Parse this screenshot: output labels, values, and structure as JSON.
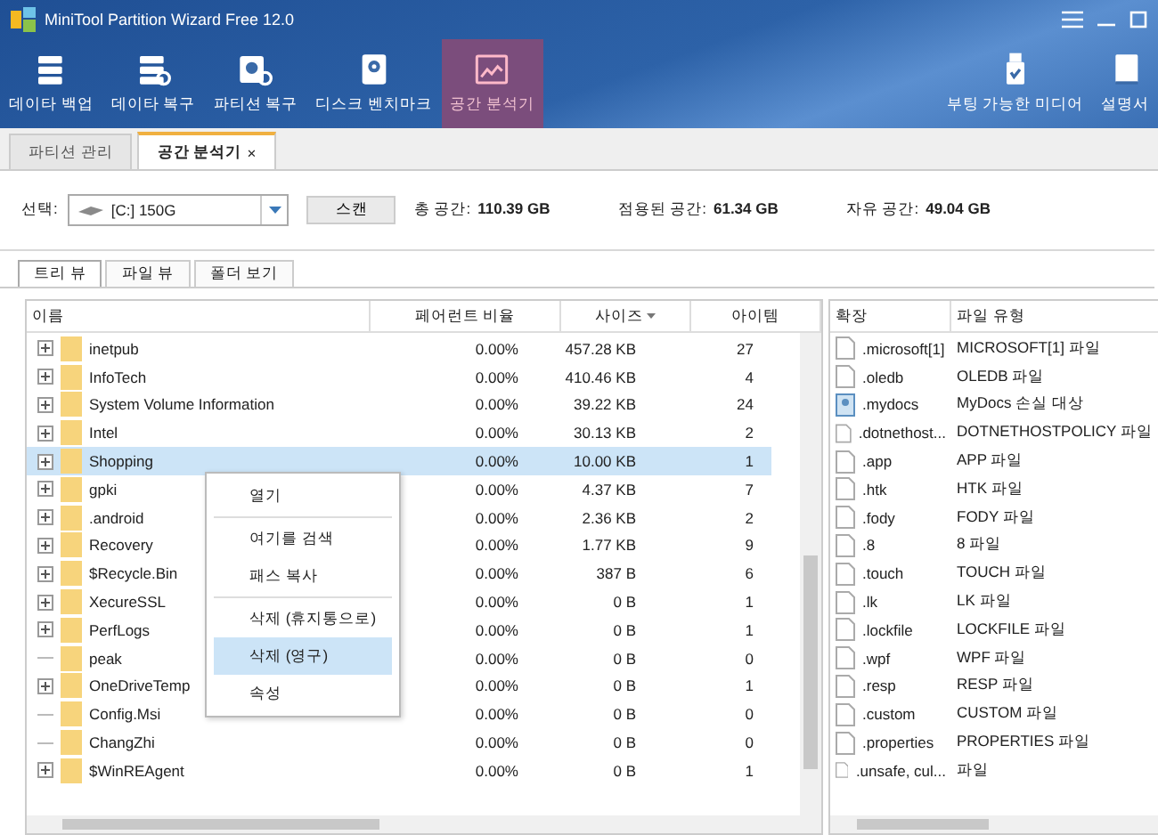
{
  "window": {
    "title": "MiniTool Partition Wizard Free 12.0"
  },
  "toolbar": {
    "left": [
      {
        "label": "데이타 백업",
        "kind": "stack",
        "selected": false
      },
      {
        "label": "데이타 복구",
        "kind": "restore",
        "selected": false
      },
      {
        "label": "파티션 복구",
        "kind": "recover",
        "selected": false
      },
      {
        "label": "디스크 벤치마크",
        "kind": "disk",
        "selected": false
      },
      {
        "label": "공간 분석기",
        "kind": "chart",
        "selected": true
      }
    ],
    "right": [
      {
        "label": "부팅 가능한 미디어",
        "kind": "usb"
      },
      {
        "label": "설명서",
        "kind": "book"
      }
    ]
  },
  "tabs": [
    {
      "label": "파티션 관리",
      "selected": false
    },
    {
      "label": "공간 분석기",
      "selected": true,
      "close": "×"
    }
  ],
  "scan": {
    "label": "선택:",
    "drive": "[C:] 150G",
    "button": "스캔",
    "stats": [
      {
        "label": "총 공간:",
        "value": "110.39 GB"
      },
      {
        "label": "점용된 공간:",
        "value": "61.34 GB"
      },
      {
        "label": "자유 공간:",
        "value": "49.04 GB"
      }
    ]
  },
  "view_tabs": [
    {
      "label": "트리 뷰",
      "selected": true
    },
    {
      "label": "파일 뷰",
      "selected": false
    },
    {
      "label": "폴더 보기",
      "selected": false
    }
  ],
  "tree_table": {
    "columns": [
      {
        "label": "이름",
        "sorted": false
      },
      {
        "label": "페어런트 비율",
        "sorted": false
      },
      {
        "label": "사이즈",
        "sorted": true
      },
      {
        "label": "아이템",
        "sorted": false
      }
    ],
    "rows": [
      {
        "name": "inetpub",
        "ratio": "0.00%",
        "size": "457.28 KB",
        "items": "27",
        "expandable": true,
        "selected": false
      },
      {
        "name": "InfoTech",
        "ratio": "0.00%",
        "size": "410.46 KB",
        "items": "4",
        "expandable": true,
        "selected": false
      },
      {
        "name": "System Volume Information",
        "ratio": "0.00%",
        "size": "39.22 KB",
        "items": "24",
        "expandable": true,
        "selected": false
      },
      {
        "name": "Intel",
        "ratio": "0.00%",
        "size": "30.13 KB",
        "items": "2",
        "expandable": true,
        "selected": false
      },
      {
        "name": "Shopping",
        "ratio": "0.00%",
        "size": "10.00 KB",
        "items": "1",
        "expandable": true,
        "selected": true
      },
      {
        "name": "gpki",
        "ratio": "0.00%",
        "size": "4.37 KB",
        "items": "7",
        "expandable": true,
        "selected": false
      },
      {
        "name": ".android",
        "ratio": "0.00%",
        "size": "2.36 KB",
        "items": "2",
        "expandable": true,
        "selected": false
      },
      {
        "name": "Recovery",
        "ratio": "0.00%",
        "size": "1.77 KB",
        "items": "9",
        "expandable": true,
        "selected": false
      },
      {
        "name": "$Recycle.Bin",
        "ratio": "0.00%",
        "size": "387 B",
        "items": "6",
        "expandable": true,
        "selected": false
      },
      {
        "name": "XecureSSL",
        "ratio": "0.00%",
        "size": "0 B",
        "items": "1",
        "expandable": true,
        "selected": false
      },
      {
        "name": "PerfLogs",
        "ratio": "0.00%",
        "size": "0 B",
        "items": "1",
        "expandable": true,
        "selected": false
      },
      {
        "name": "peak",
        "ratio": "0.00%",
        "size": "0 B",
        "items": "0",
        "expandable": false,
        "selected": false
      },
      {
        "name": "OneDriveTemp",
        "ratio": "0.00%",
        "size": "0 B",
        "items": "1",
        "expandable": true,
        "selected": false
      },
      {
        "name": "Config.Msi",
        "ratio": "0.00%",
        "size": "0 B",
        "items": "0",
        "expandable": false,
        "selected": false
      },
      {
        "name": "ChangZhi",
        "ratio": "0.00%",
        "size": "0 B",
        "items": "0",
        "expandable": false,
        "selected": false
      },
      {
        "name": "$WinREAgent",
        "ratio": "0.00%",
        "size": "0 B",
        "items": "1",
        "expandable": true,
        "selected": false
      }
    ]
  },
  "context_menu": {
    "groups": [
      [
        {
          "label": "열기",
          "selected": false
        }
      ],
      [
        {
          "label": "여기를 검색",
          "selected": false
        },
        {
          "label": "패스 복사",
          "selected": false
        }
      ],
      [
        {
          "label": "삭제 (휴지통으로)",
          "selected": false
        },
        {
          "label": "삭제 (영구)",
          "selected": true
        },
        {
          "label": "속성",
          "selected": false
        }
      ]
    ]
  },
  "extension_table": {
    "columns": [
      "확장",
      "파일 유형"
    ],
    "rows": [
      {
        "ext": ".microsoft[1]",
        "type": "MICROSOFT[1] 파일",
        "kind": "file"
      },
      {
        "ext": ".oledb",
        "type": "OLEDB 파일",
        "kind": "file"
      },
      {
        "ext": ".mydocs",
        "type": "MyDocs 손실 대상",
        "kind": "special"
      },
      {
        "ext": ".dotnethost...",
        "type": "DOTNETHOSTPOLICY 파일",
        "kind": "file"
      },
      {
        "ext": ".app",
        "type": "APP 파일",
        "kind": "file"
      },
      {
        "ext": ".htk",
        "type": "HTK 파일",
        "kind": "file"
      },
      {
        "ext": ".fody",
        "type": "FODY 파일",
        "kind": "file"
      },
      {
        "ext": ".8",
        "type": "8 파일",
        "kind": "file"
      },
      {
        "ext": ".touch",
        "type": "TOUCH 파일",
        "kind": "file"
      },
      {
        "ext": ".lk",
        "type": "LK 파일",
        "kind": "file"
      },
      {
        "ext": ".lockfile",
        "type": "LOCKFILE 파일",
        "kind": "file"
      },
      {
        "ext": ".wpf",
        "type": "WPF 파일",
        "kind": "file"
      },
      {
        "ext": ".resp",
        "type": "RESP 파일",
        "kind": "file"
      },
      {
        "ext": ".custom",
        "type": "CUSTOM 파일",
        "kind": "file"
      },
      {
        "ext": ".properties",
        "type": "PROPERTIES 파일",
        "kind": "file"
      },
      {
        "ext": ".unsafe, cul...",
        "type": "파일",
        "kind": "file"
      }
    ]
  }
}
